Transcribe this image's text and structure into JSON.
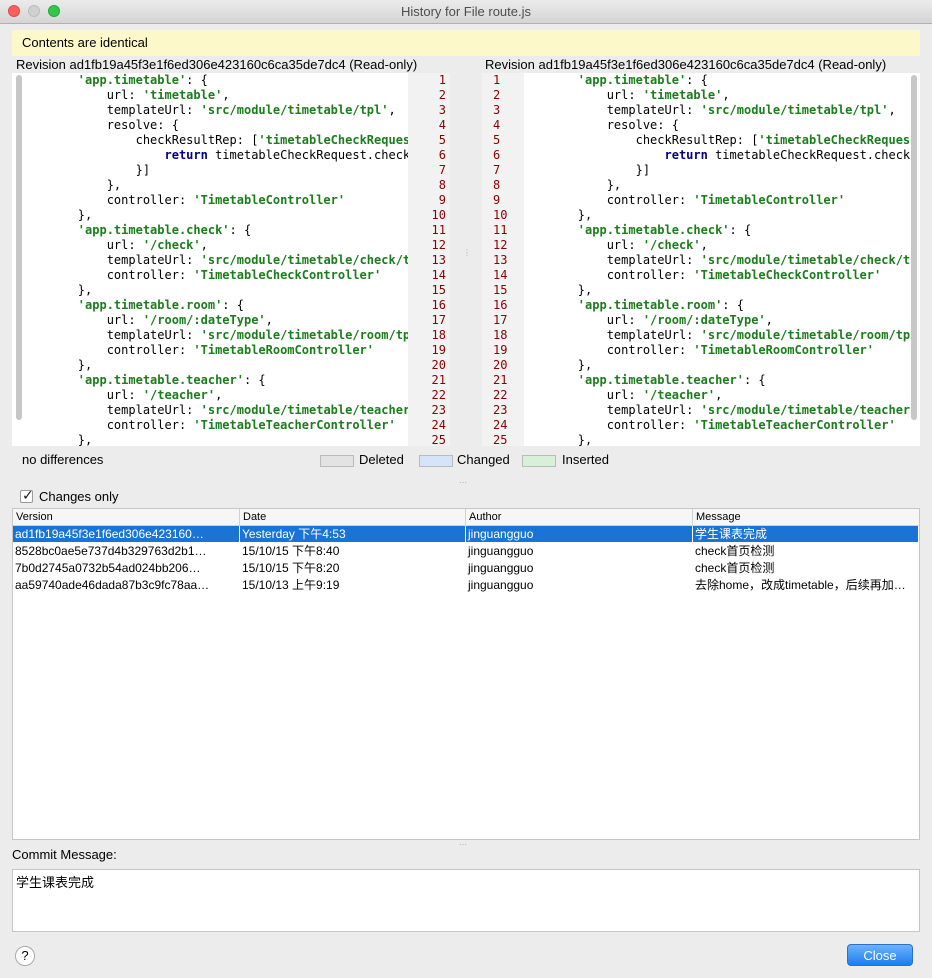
{
  "window": {
    "title": "History for File route.js"
  },
  "banner": "Contents are identical",
  "left_revision": "Revision ad1fb19a45f3e1f6ed306e423160c6ca35de7dc4 (Read-only)",
  "right_revision": "Revision ad1fb19a45f3e1f6ed306e423160c6ca35de7dc4 (Read-only)",
  "line_numbers": [
    "1",
    "2",
    "3",
    "4",
    "5",
    "6",
    "7",
    "8",
    "9",
    "10",
    "11",
    "12",
    "13",
    "14",
    "15",
    "16",
    "17",
    "18",
    "19",
    "20",
    "21",
    "22",
    "23",
    "24",
    "25"
  ],
  "code_lines": [
    [
      {
        "t": "        "
      },
      {
        "t": "'app.timetable'",
        "c": "str"
      },
      {
        "t": ": {"
      }
    ],
    [
      {
        "t": "            url: "
      },
      {
        "t": "'timetable'",
        "c": "str"
      },
      {
        "t": ","
      }
    ],
    [
      {
        "t": "            templateUrl: "
      },
      {
        "t": "'src/module/timetable/tpl'",
        "c": "str"
      },
      {
        "t": ","
      }
    ],
    [
      {
        "t": "            resolve: {"
      }
    ],
    [
      {
        "t": "                checkResultRep: ["
      },
      {
        "t": "'timetableCheckReques",
        "c": "str"
      }
    ],
    [
      {
        "t": "                    "
      },
      {
        "t": "return",
        "c": "kw"
      },
      {
        "t": " timetableCheckRequest.check"
      }
    ],
    [
      {
        "t": "                }]"
      }
    ],
    [
      {
        "t": "            },"
      }
    ],
    [
      {
        "t": "            controller: "
      },
      {
        "t": "'TimetableController'",
        "c": "str"
      }
    ],
    [
      {
        "t": "        },"
      }
    ],
    [
      {
        "t": "        "
      },
      {
        "t": "'app.timetable.check'",
        "c": "str"
      },
      {
        "t": ": {"
      }
    ],
    [
      {
        "t": "            url: "
      },
      {
        "t": "'/check'",
        "c": "str"
      },
      {
        "t": ","
      }
    ],
    [
      {
        "t": "            templateUrl: "
      },
      {
        "t": "'src/module/timetable/check/t",
        "c": "str"
      }
    ],
    [
      {
        "t": "            controller: "
      },
      {
        "t": "'TimetableCheckController'",
        "c": "str"
      }
    ],
    [
      {
        "t": "        },"
      }
    ],
    [
      {
        "t": "        "
      },
      {
        "t": "'app.timetable.room'",
        "c": "str"
      },
      {
        "t": ": {"
      }
    ],
    [
      {
        "t": "            url: "
      },
      {
        "t": "'/room/:dateType'",
        "c": "str"
      },
      {
        "t": ","
      }
    ],
    [
      {
        "t": "            templateUrl: "
      },
      {
        "t": "'src/module/timetable/room/tp",
        "c": "str"
      }
    ],
    [
      {
        "t": "            controller: "
      },
      {
        "t": "'TimetableRoomController'",
        "c": "str"
      }
    ],
    [
      {
        "t": "        },"
      }
    ],
    [
      {
        "t": "        "
      },
      {
        "t": "'app.timetable.teacher'",
        "c": "str"
      },
      {
        "t": ": {"
      }
    ],
    [
      {
        "t": "            url: "
      },
      {
        "t": "'/teacher'",
        "c": "str"
      },
      {
        "t": ","
      }
    ],
    [
      {
        "t": "            templateUrl: "
      },
      {
        "t": "'src/module/timetable/teacher",
        "c": "str"
      }
    ],
    [
      {
        "t": "            controller: "
      },
      {
        "t": "'TimetableTeacherController'",
        "c": "str"
      }
    ],
    [
      {
        "t": "        },"
      }
    ]
  ],
  "status": {
    "diff_summary": "no differences",
    "legend": [
      {
        "label": "Deleted",
        "color": "#e3e3e3"
      },
      {
        "label": "Changed",
        "color": "#d6e4fa"
      },
      {
        "label": "Inserted",
        "color": "#d7f0d7"
      }
    ]
  },
  "changes_only": {
    "label": "Changes only",
    "checked": true
  },
  "table": {
    "columns": [
      "Version",
      "Date",
      "Author",
      "Message"
    ],
    "rows": [
      {
        "version": "ad1fb19a45f3e1f6ed306e423160…",
        "date": "Yesterday 下午4:53",
        "author": "jinguangguo",
        "message": "学生课表完成",
        "selected": true
      },
      {
        "version": "8528bc0ae5e737d4b329763d2b1…",
        "date": "15/10/15 下午8:40",
        "author": "jinguangguo",
        "message": "check首页检测",
        "selected": false
      },
      {
        "version": "7b0d2745a0732b54ad024bb206…",
        "date": "15/10/15 下午8:20",
        "author": "jinguangguo",
        "message": "check首页检测",
        "selected": false
      },
      {
        "version": "aa59740ade46dada87b3c9fc78aa…",
        "date": "15/10/13 上午9:19",
        "author": "jinguangguo",
        "message": "去除home，改成timetable，后续再加…",
        "selected": false
      }
    ]
  },
  "commit": {
    "label": "Commit Message:",
    "text": "学生课表完成"
  },
  "buttons": {
    "help": "?",
    "close": "Close"
  }
}
